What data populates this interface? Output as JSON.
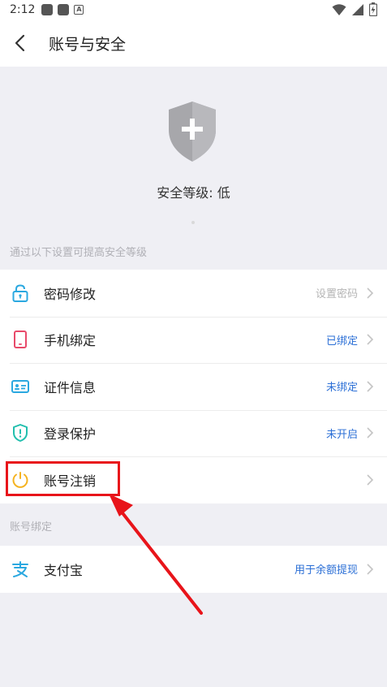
{
  "status_bar": {
    "time": "2:12"
  },
  "nav": {
    "title": "账号与安全"
  },
  "hero": {
    "level_text": "安全等级: 低"
  },
  "section1": {
    "header": "通过以下设置可提高安全等级",
    "items": [
      {
        "label": "密码修改",
        "value": "设置密码",
        "value_style": "grey",
        "icon": "unlock-icon",
        "color": "#2ba8e0"
      },
      {
        "label": "手机绑定",
        "value": "已绑定",
        "value_style": "blue",
        "icon": "phone-icon",
        "color": "#e84a6a"
      },
      {
        "label": "证件信息",
        "value": "未绑定",
        "value_style": "blue",
        "icon": "id-card-icon",
        "color": "#2ba8e0"
      },
      {
        "label": "登录保护",
        "value": "未开启",
        "value_style": "blue",
        "icon": "shield-alert-icon",
        "color": "#22bfae"
      },
      {
        "label": "账号注销",
        "value": "",
        "value_style": "grey",
        "icon": "power-icon",
        "color": "#f5b320"
      }
    ]
  },
  "section2": {
    "header": "账号绑定",
    "items": [
      {
        "label": "支付宝",
        "value": "用于余额提现",
        "value_style": "blue",
        "icon": "alipay-icon",
        "color": "#2ba8e0"
      }
    ]
  },
  "colors": {
    "accent_blue": "#2b6fd6",
    "annotation_red": "#e8141a",
    "background": "#efeff4"
  }
}
